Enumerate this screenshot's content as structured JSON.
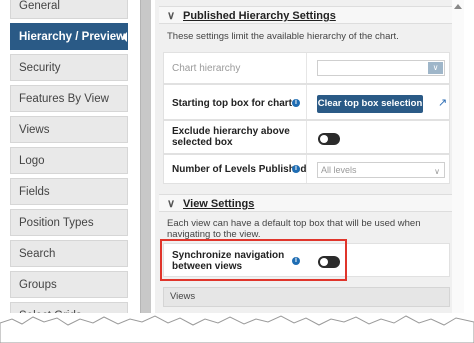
{
  "sidebar": {
    "items": [
      {
        "label": "General",
        "active": false
      },
      {
        "label": "Hierarchy / Preview",
        "active": true
      },
      {
        "label": "Security",
        "active": false
      },
      {
        "label": "Features By View",
        "active": false
      },
      {
        "label": "Views",
        "active": false
      },
      {
        "label": "Logo",
        "active": false
      },
      {
        "label": "Fields",
        "active": false
      },
      {
        "label": "Position Types",
        "active": false
      },
      {
        "label": "Search",
        "active": false
      },
      {
        "label": "Groups",
        "active": false
      },
      {
        "label": "Select Grids",
        "active": false
      }
    ]
  },
  "published_hierarchy": {
    "title": "Published Hierarchy Settings",
    "chevron": "chevron-down-icon",
    "description": "These settings limit the available hierarchy of the chart.",
    "chart_hierarchy_label": "Chart hierarchy",
    "chart_hierarchy_value": "",
    "starting_top_box_label": "Starting top box for chart",
    "clear_top_box_button": "Clear top box selection",
    "exclude_hierarchy_label": "Exclude hierarchy above selected box",
    "exclude_hierarchy_enabled": false,
    "levels_label": "Number of Levels Published",
    "levels_value": "All levels"
  },
  "view_settings": {
    "title": "View Settings",
    "chevron": "chevron-down-icon",
    "description": "Each view can have a default top box that will be used when navigating to the view.",
    "sync_label": "Synchronize navigation between views",
    "sync_enabled": false,
    "views_header": "Views"
  },
  "colors": {
    "active_tab": "#2a5a86",
    "primary_button": "#2a5a86",
    "highlight_border": "#e0352b",
    "info_icon": "#1f6db3"
  }
}
